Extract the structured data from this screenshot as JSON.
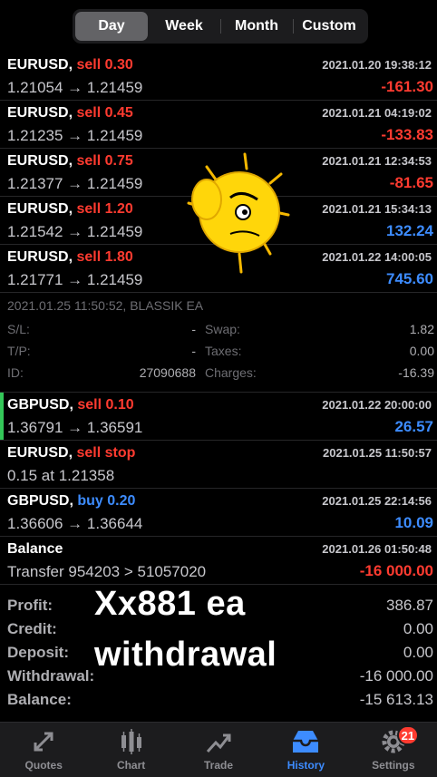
{
  "periods": [
    "Day",
    "Week",
    "Month",
    "Custom"
  ],
  "active_period": "Day",
  "deals": [
    {
      "symbol": "EURUSD,",
      "side": "sell 0.30",
      "side_type": "sell",
      "time": "2021.01.20 19:38:12",
      "prices": "1.21054 → 1.21459",
      "profit": "-161.30",
      "profit_sign": "neg"
    },
    {
      "symbol": "EURUSD,",
      "side": "sell 0.45",
      "side_type": "sell",
      "time": "2021.01.21 04:19:02",
      "prices": "1.21235 → 1.21459",
      "profit": "-133.83",
      "profit_sign": "neg"
    },
    {
      "symbol": "EURUSD,",
      "side": "sell 0.75",
      "side_type": "sell",
      "time": "2021.01.21 12:34:53",
      "prices": "1.21377 → 1.21459",
      "profit": "-81.65",
      "profit_sign": "neg"
    },
    {
      "symbol": "EURUSD,",
      "side": "sell 1.20",
      "side_type": "sell",
      "time": "2021.01.21 15:34:13",
      "prices": "1.21542 → 1.21459",
      "profit": "132.24",
      "profit_sign": "pos"
    },
    {
      "symbol": "EURUSD,",
      "side": "sell 1.80",
      "side_type": "sell",
      "time": "2021.01.22 14:00:05",
      "prices": "1.21771 → 1.21459",
      "profit": "745.60",
      "profit_sign": "pos"
    }
  ],
  "detail": {
    "header": "2021.01.25 11:50:52, BLASSIK EA",
    "sl_label": "S/L:",
    "sl_value": "-",
    "tp_label": "T/P:",
    "tp_value": "-",
    "id_label": "ID:",
    "id_value": "27090688",
    "swap_label": "Swap:",
    "swap_value": "1.82",
    "taxes_label": "Taxes:",
    "taxes_value": "0.00",
    "charges_label": "Charges:",
    "charges_value": "-16.39"
  },
  "deals2": [
    {
      "symbol": "GBPUSD,",
      "side": "sell 0.10",
      "side_type": "sell",
      "time": "2021.01.22 20:00:00",
      "prices": "1.36791 → 1.36591",
      "profit": "26.57",
      "profit_sign": "pos",
      "selected": true
    },
    {
      "symbol": "EURUSD,",
      "side": "sell stop",
      "side_type": "sell",
      "time": "2021.01.25 11:50:57",
      "prices": "0.15 at 1.21358",
      "profit": "",
      "profit_sign": "pos"
    },
    {
      "symbol": "GBPUSD,",
      "side": "buy 0.20",
      "side_type": "buy",
      "time": "2021.01.25 22:14:56",
      "prices": "1.36606 → 1.36644",
      "profit": "10.09",
      "profit_sign": "pos"
    },
    {
      "symbol": "Balance",
      "side": "",
      "side_type": "sell",
      "time": "2021.01.26 01:50:48",
      "prices": "Transfer 954203 > 51057020",
      "profit": "-16 000.00",
      "profit_sign": "neg"
    }
  ],
  "summary": [
    {
      "label": "Profit:",
      "value": "386.87"
    },
    {
      "label": "Credit:",
      "value": "0.00"
    },
    {
      "label": "Deposit:",
      "value": "0.00"
    },
    {
      "label": "Withdrawal:",
      "value": "-16 000.00"
    },
    {
      "label": "Balance:",
      "value": "-15 613.13"
    }
  ],
  "overlay_text": [
    "Xx881 ea",
    "withdrawal"
  ],
  "tabs": [
    {
      "label": "Quotes",
      "icon": "quotes-icon"
    },
    {
      "label": "Chart",
      "icon": "chart-icon"
    },
    {
      "label": "Trade",
      "icon": "trade-icon"
    },
    {
      "label": "History",
      "icon": "history-icon"
    },
    {
      "label": "Settings",
      "icon": "gear-icon",
      "badge": "21"
    }
  ],
  "active_tab": "History",
  "colors": {
    "loss": "#ff3b30",
    "gain": "#3d8cff",
    "active_tab": "#3d8cff",
    "selected_marker": "#34c759"
  }
}
